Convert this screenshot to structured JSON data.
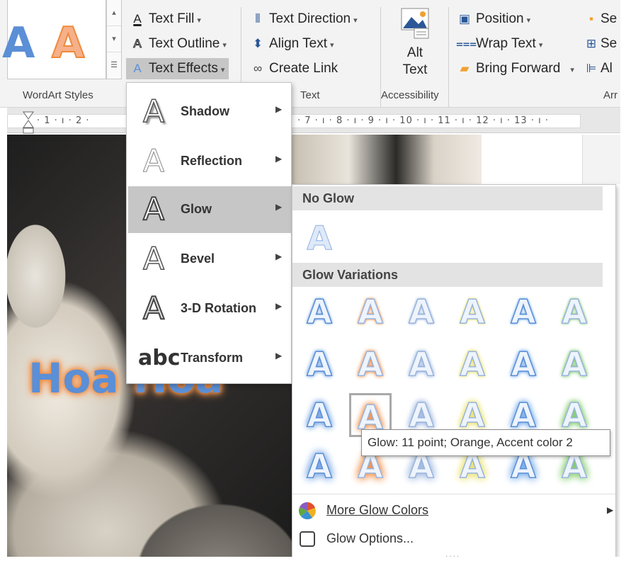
{
  "ribbon": {
    "gallery_letters": [
      "A",
      "A"
    ],
    "text_fill": "Text Fill",
    "text_outline": "Text Outline",
    "text_effects": "Text Effects",
    "text_direction": "Text Direction",
    "align_text": "Align Text",
    "create_link": "Create Link",
    "alt_text_line1": "Alt",
    "alt_text_line2": "Text",
    "position": "Position",
    "wrap_text": "Wrap Text",
    "bring_forward": "Bring Forward",
    "cut_se": "Se",
    "cut_se2": "Se",
    "cut_al": "Al",
    "groups": {
      "wordart_styles": "WordArt Styles",
      "text": "Text",
      "accessibility": "Accessibility",
      "arrange_cut": "Arr"
    }
  },
  "ruler": {
    "left": "· 1 · ı · 2 ·",
    "right": "· 7 · ı · 8 · ı · 9 · ı · 10 · ı · 11 · ı · 12 · ı · 13 · ı ·"
  },
  "document": {
    "wordart_text": "Hoa Hoa"
  },
  "effects_menu": {
    "items": [
      {
        "label": "Shadow",
        "glyph": "A"
      },
      {
        "label": "Reflection",
        "glyph": "A"
      },
      {
        "label": "Glow",
        "glyph": "A"
      },
      {
        "label": "Bevel",
        "glyph": "A"
      },
      {
        "label": "3-D Rotation",
        "glyph": "A"
      },
      {
        "label": "Transform",
        "glyph": "abc"
      }
    ]
  },
  "glow_menu": {
    "no_glow_header": "No Glow",
    "variations_header": "Glow Variations",
    "glyph": "A",
    "glow_colors": [
      "#6fa0e0",
      "#f0883c",
      "#9ab4dc",
      "#e8e060",
      "#6fa8e8",
      "#78c860"
    ],
    "more_colors": "More Glow Colors",
    "options": "Glow Options...",
    "tooltip": "Glow: 11 point; Orange, Accent color 2"
  },
  "colors": {
    "accent_blue": "#2b5797",
    "wordart_fill": "#5b8fd6",
    "wordart_glow": "#f08a3c"
  }
}
